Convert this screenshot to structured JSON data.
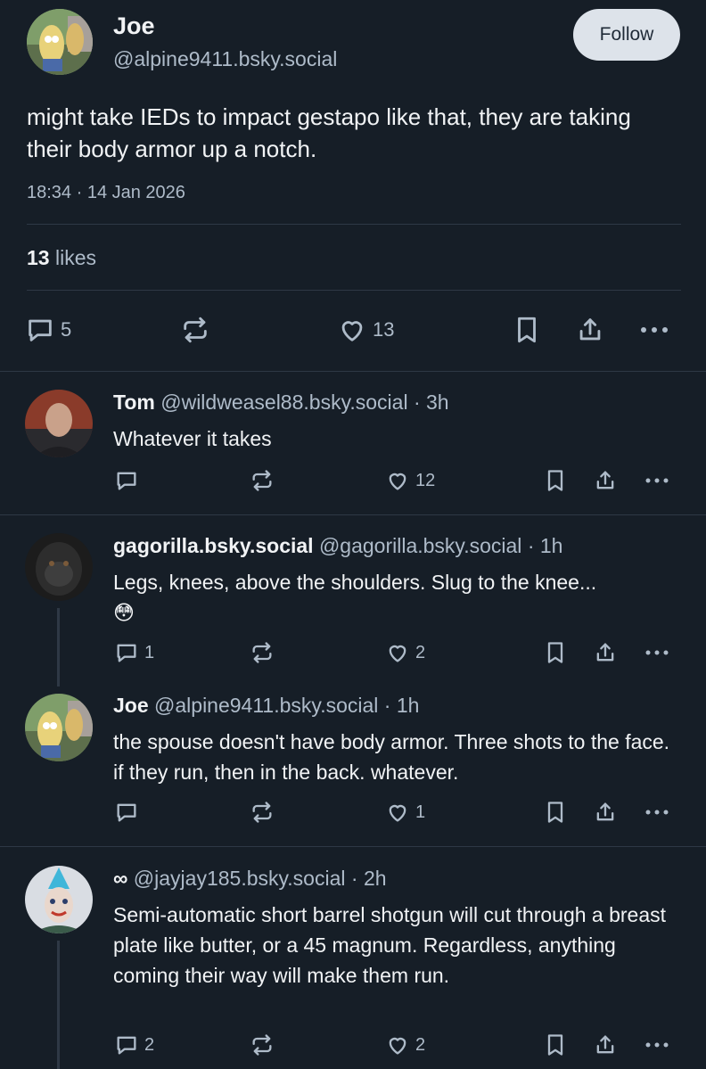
{
  "post": {
    "author_name": "Joe",
    "author_handle": "@alpine9411.bsky.social",
    "follow_label": "Follow",
    "text": "might take IEDs to impact gestapo like that, they are taking their body armor up a notch.",
    "timestamp": "18:34 · 14 Jan 2026",
    "likes_count": "13",
    "likes_label": "likes",
    "reply_count": "5",
    "like_count": "13"
  },
  "replies": [
    {
      "name": "Tom",
      "handle": "@wildweasel88.bsky.social",
      "time": "· 3h",
      "text": "Whatever it takes",
      "reply_count": "",
      "like_count": "12"
    },
    {
      "name": "gagorilla.bsky.social",
      "handle": "@gagorilla.bsky.social",
      "time": "· 1h",
      "text": "Legs, knees, above the shoulders. Slug to the knee...",
      "emoji": "😳",
      "reply_count": "1",
      "like_count": "2"
    },
    {
      "name": "Joe",
      "handle": "@alpine9411.bsky.social",
      "time": "· 1h",
      "text": "the spouse doesn't have body armor. Three shots to the face. if they run, then in the back. whatever.",
      "reply_count": "",
      "like_count": "1"
    },
    {
      "name": "∞",
      "handle": "@jayjay185.bsky.social",
      "time": "· 2h",
      "text": "Semi-automatic short barrel shotgun will cut through a breast plate like butter, or a 45 magnum. Regardless, anything coming their way will make them run.",
      "reply_count": "2",
      "like_count": "2"
    }
  ],
  "colors": {
    "background": "#161e27",
    "muted": "#aebbc9",
    "divider": "#2e3845",
    "follow_bg": "#dde3ea"
  }
}
